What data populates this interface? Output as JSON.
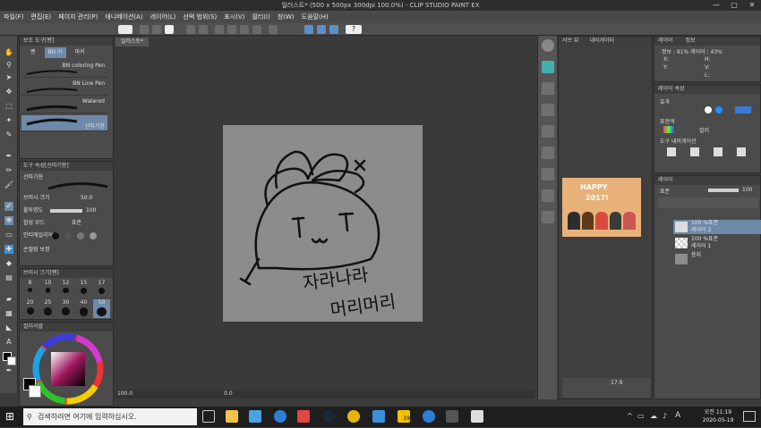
{
  "window": {
    "title": "일러스트* (500 x 500px 300dpi 100.0%) - CLIP STUDIO PAINT EX",
    "min": "—",
    "max": "▢",
    "close": "✕"
  },
  "menu": [
    "파일(F)",
    "편집(E)",
    "페이지 관리(P)",
    "애니메이션(A)",
    "레이어(L)",
    "선택 범위(S)",
    "표시(V)",
    "필터(I)",
    "창(W)",
    "도움말(H)"
  ],
  "canvas_tab": "일러스트*",
  "subtool": {
    "header": "보조 도구[펜]",
    "tabs": [
      "펜",
      "BN 라",
      "마커"
    ],
    "brushes": [
      "BN coloring Pen",
      "BN Line Pen",
      "Watered",
      "선따기용"
    ]
  },
  "tool_property": {
    "header": "도구 속성[선따기용]",
    "name": "선따기용",
    "rows": [
      {
        "label": "브러시 크기",
        "value": "50.0"
      },
      {
        "label": "불투명도",
        "value": "100"
      },
      {
        "label": "합성 모드",
        "value": "표준"
      },
      {
        "label": "안티에일리어싱",
        "value": ""
      },
      {
        "label": "손떨림 보정",
        "value": ""
      }
    ]
  },
  "brush_size": {
    "header": "브러시 크기[펜]",
    "sizes": [
      "8",
      "10",
      "12",
      "15",
      "17",
      "20",
      "25",
      "30",
      "40",
      "50"
    ]
  },
  "color_header": "컬러서클",
  "color": {
    "main": "#050505",
    "sub": "#ffffff",
    "hue_tint": "#a01860"
  },
  "canvas_text": {
    "line1": "자라나라",
    "line2": "머리머리"
  },
  "status": {
    "zoom": "100.0",
    "coords": "0.0"
  },
  "navigator": {
    "header": "내비게이터",
    "tabs": [
      "서브 뷰",
      "내비게이터"
    ],
    "image_text_1": "HAPPY",
    "image_text_2": "2017!",
    "zoom": "17.9"
  },
  "info": {
    "header": "정보",
    "tabs": [
      "레이어",
      "정보"
    ],
    "text": "정보 : 91% 레이어 : 43%",
    "labels": [
      "X:",
      "Y:",
      "H:",
      "V:",
      "L:"
    ]
  },
  "layer_property": {
    "header": "레이어 속성",
    "effect_label": "효과",
    "expression_label": "표현색",
    "expression_value": "컬러",
    "tool_nav_label": "도구 내비게이션"
  },
  "layers": {
    "header": "레이어",
    "blend": "표준",
    "opacity": "100",
    "items": [
      {
        "name": "100 %표준",
        "sub": "레이어 2"
      },
      {
        "name": "100 %표준",
        "sub": "레이어 1"
      },
      {
        "name": "",
        "sub": "용지"
      }
    ]
  },
  "taskbar": {
    "search_placeholder": "검색하려면 여기에 입력하십시오.",
    "time": "오전 11:19",
    "date": "2020-05-19",
    "ime": "A",
    "badge": "19"
  }
}
